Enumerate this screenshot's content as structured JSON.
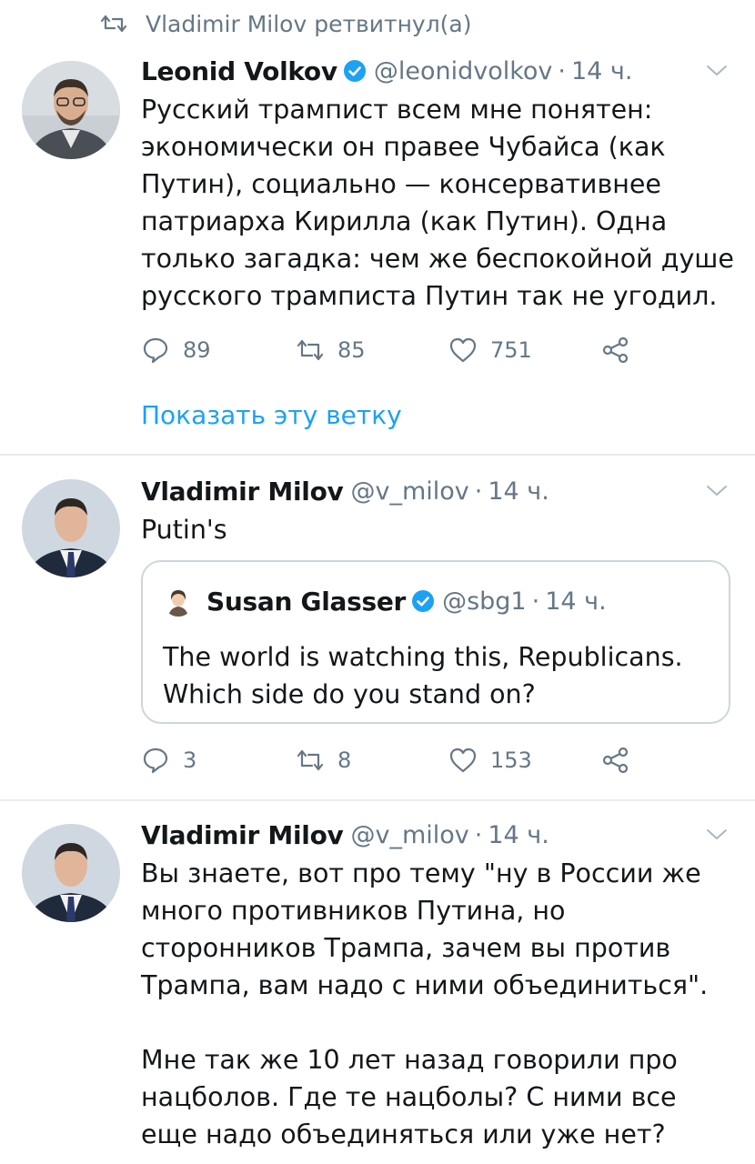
{
  "retweet_context": {
    "label": "Vladimir Milov ретвитнул(а)"
  },
  "tweets": [
    {
      "author": {
        "name": "Leonid Volkov",
        "handle": "@leonidvolkov",
        "verified": true
      },
      "time": "14 ч.",
      "text": "Русский трампист всем мне понятен:\nэкономически он правее Чубайса (как\nПутин), социально — консервативнее\nпатриарха Кирилла (как Путин). Одна\nтолько загадка: чем же беспокойной душе\nрусского трамписта Путин так не угодил.",
      "actions": {
        "replies": "89",
        "retweets": "85",
        "likes": "751"
      },
      "thread_link": "Показать эту ветку"
    },
    {
      "author": {
        "name": "Vladimir Milov",
        "handle": "@v_milov",
        "verified": false
      },
      "time": "14 ч.",
      "text": "Putin's",
      "quote": {
        "author": {
          "name": "Susan Glasser",
          "handle": "@sbg1",
          "verified": true
        },
        "time": "14 ч.",
        "text": "The world is watching this, Republicans.\nWhich side do you stand on?"
      },
      "actions": {
        "replies": "3",
        "retweets": "8",
        "likes": "153"
      }
    },
    {
      "author": {
        "name": "Vladimir Milov",
        "handle": "@v_milov",
        "verified": false
      },
      "time": "14 ч.",
      "text": "Вы знаете, вот про тему \"ну в России же\nмного противников Путина, но\nсторонников Трампа, зачем вы против\nТрампа, вам надо с ними объединиться\".\n\nМне так же 10 лет назад говорили про\nнацболов. Где те нацболы? С ними все\nеще надо объединяться или уже нет?"
    }
  ],
  "colors": {
    "accent": "#1da1f2",
    "muted": "#657786",
    "text": "#14171a",
    "border": "#e6ecf0"
  },
  "icons": [
    "retweet-icon",
    "verified-icon",
    "chevron-down-icon",
    "reply-icon",
    "like-icon",
    "share-icon"
  ]
}
